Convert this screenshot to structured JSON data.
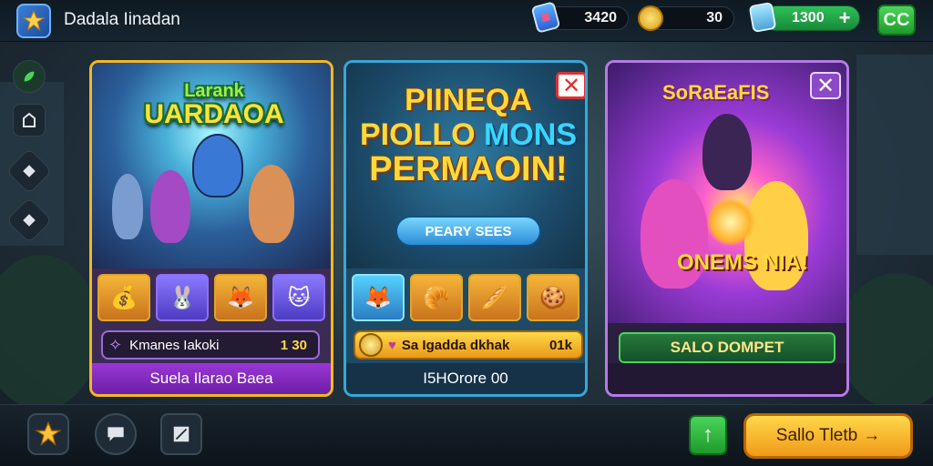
{
  "header": {
    "title": "Dadala Iinadan",
    "tickets": "3420",
    "coins": "30",
    "gems": "1300",
    "plus_label": "+",
    "cc_label": "CC"
  },
  "sidebar": {
    "items": [
      {
        "icon": "leaf-icon"
      },
      {
        "icon": "tower-icon"
      },
      {
        "icon": "map-icon"
      },
      {
        "icon": "compass-icon"
      }
    ]
  },
  "cards": [
    {
      "art_title_small": "Larank",
      "art_title": "UARDAOA",
      "price_label": "Kmanes Iakoki",
      "price_value": "1 30",
      "footer": "Suela Ilarao Baea",
      "items": [
        "item-bag",
        "item-bunny",
        "item-fox",
        "item-cat"
      ]
    },
    {
      "promo_line1": "PIINEQA",
      "promo_line2a": "PIOLLO",
      "promo_line2b": "MONS",
      "promo_line3": "PERMAOIN!",
      "button_label": "PEARY SEES",
      "items": [
        "item-fox",
        "item-bread",
        "item-baguette",
        "item-cookie"
      ],
      "offer_label": "Sa Igadda dkhak",
      "offer_value": "01k",
      "footer": "I5HOrore 00"
    },
    {
      "art_title": "SoRaEaFIS",
      "art_banner": "ONEMS NIA!",
      "button_label": "SALO DOMPET"
    }
  ],
  "footer": {
    "next_label": "Sallo Tletb",
    "arrow": "→",
    "up_arrow": "↑"
  },
  "colors": {
    "card1_border": "#f2b822",
    "card2_border": "#37a7d8",
    "card3_border": "#b77ae6",
    "accent_green": "#2fbf59",
    "accent_yellow": "#ffd84a"
  }
}
